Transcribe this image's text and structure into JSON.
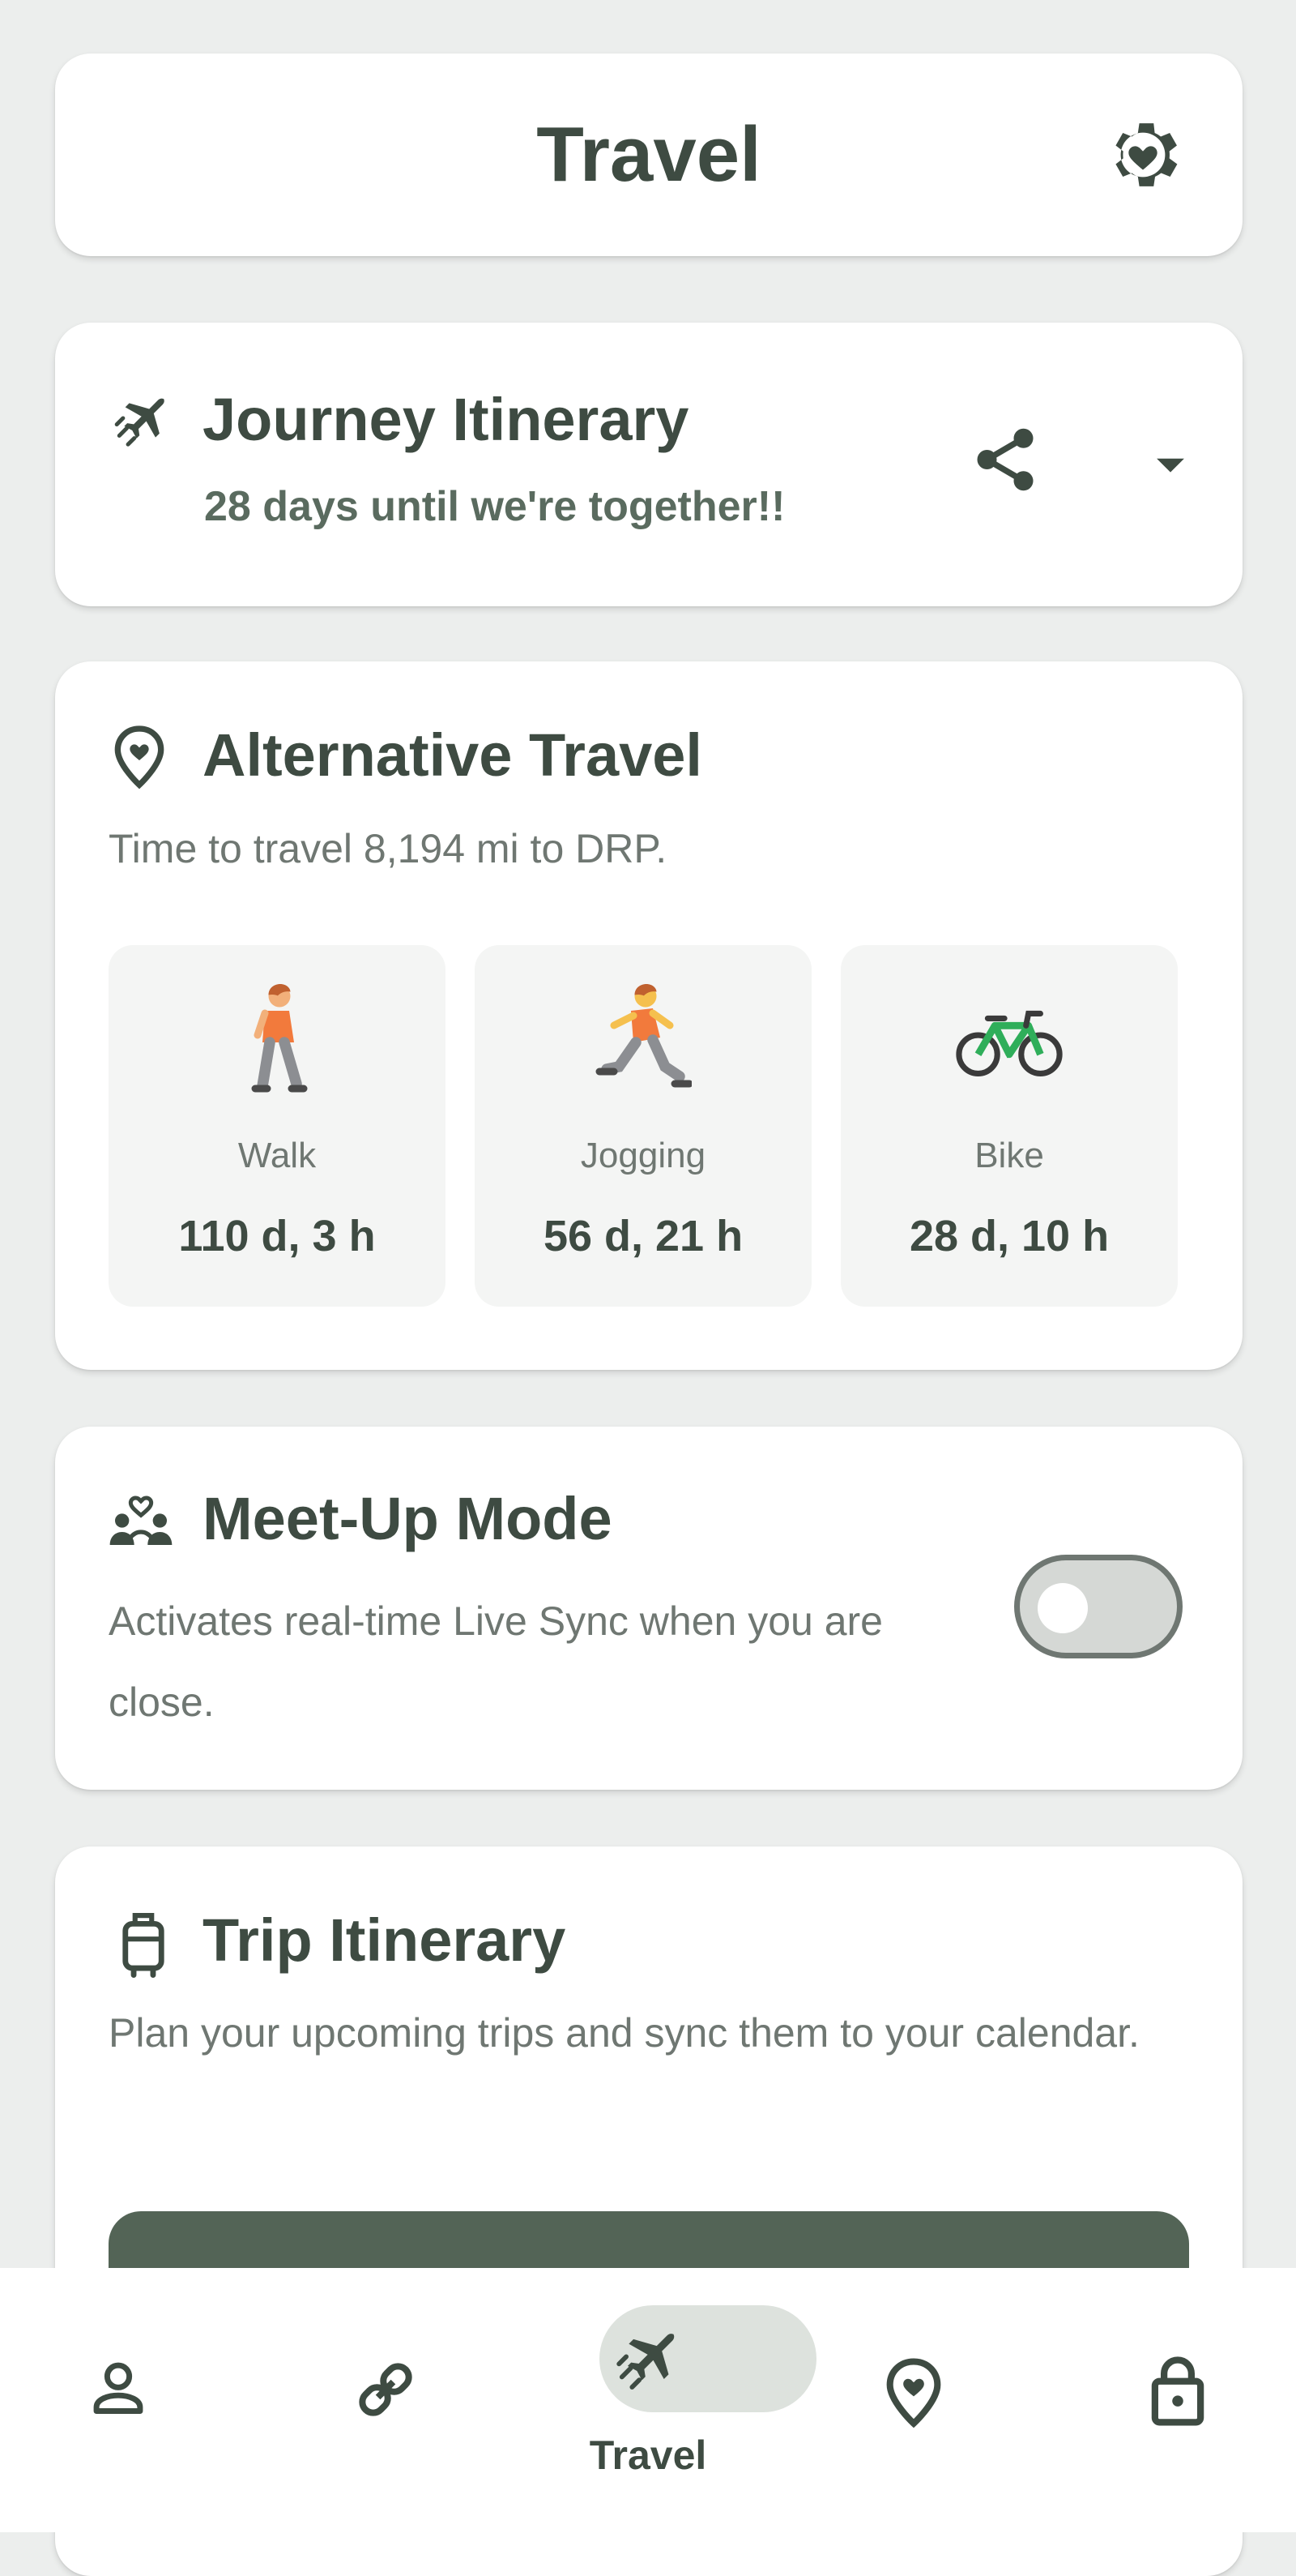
{
  "header": {
    "title": "Travel",
    "settings_icon": "gear-heart-icon"
  },
  "journey": {
    "title": "Journey Itinerary",
    "subtitle": "28 days until we're together!!",
    "icon": "flight-icon",
    "share_icon": "share-icon",
    "expand_icon": "caret-down-icon"
  },
  "alternative_travel": {
    "title": "Alternative Travel",
    "subtitle": "Time to travel 8,194 mi to DRP.",
    "icon": "location-heart-icon",
    "modes": [
      {
        "label": "Walk",
        "value": "110 d, 3 h",
        "icon": "walking-person-icon"
      },
      {
        "label": "Jogging",
        "value": "56 d, 21 h",
        "icon": "running-person-icon"
      },
      {
        "label": "Bike",
        "value": "28 d, 10 h",
        "icon": "bicycle-icon"
      }
    ]
  },
  "meetup": {
    "title": "Meet-Up Mode",
    "description": "Activates real-time Live Sync when you are close.",
    "toggle_on": false,
    "icon": "group-heart-icon"
  },
  "trip": {
    "title": "Trip Itinerary",
    "description": "Plan your upcoming trips and sync them to your calendar.",
    "icon": "luggage-icon"
  },
  "nav": {
    "items": [
      {
        "name": "profile",
        "icon": "person-icon"
      },
      {
        "name": "link",
        "icon": "link-icon"
      },
      {
        "name": "travel",
        "icon": "flight-icon",
        "label": "Travel",
        "active": true
      },
      {
        "name": "location",
        "icon": "location-heart-icon"
      },
      {
        "name": "lock",
        "icon": "lock-icon"
      }
    ]
  },
  "colors": {
    "text": "#3e4b42",
    "muted": "#6f7772",
    "accent": "#536456",
    "background": "#eceeed"
  }
}
